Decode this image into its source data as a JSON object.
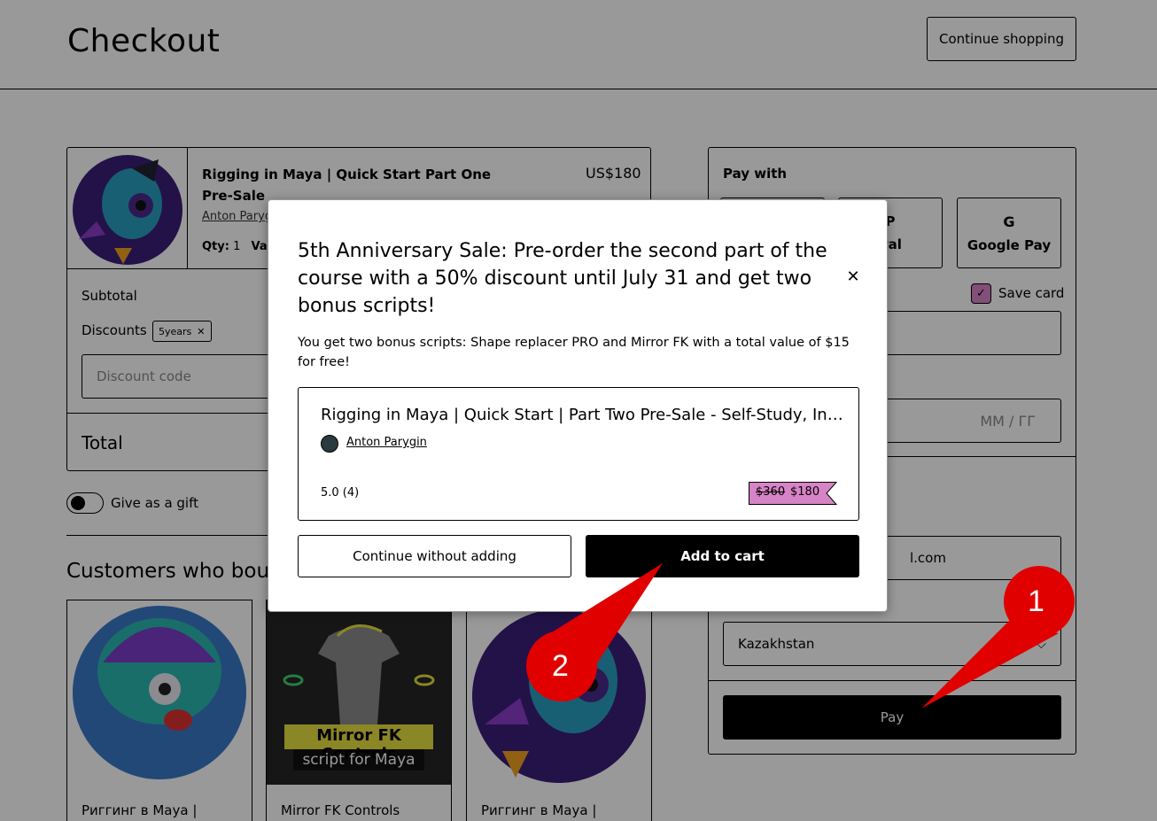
{
  "header": {
    "title": "Checkout",
    "continue_shopping": "Continue shopping"
  },
  "cart": {
    "item": {
      "title": "Rigging in Maya | Quick Start Part One Pre-Sale",
      "price": "US$180",
      "author": "Anton Paryg",
      "qty_label": "Qty:",
      "qty_value": "1",
      "variant_label": "Var"
    },
    "subtotal_label": "Subtotal",
    "discounts_label": "Discounts",
    "discount_chip": "5years",
    "discount_placeholder": "Discount code",
    "total_label": "Total"
  },
  "gift": {
    "label": "Give as a gift",
    "enabled": false
  },
  "customers_heading": "Customers who boug",
  "products": [
    {
      "title": "Риггинг в Maya |"
    },
    {
      "title": "Mirror FK Controls",
      "image_caption_1": "Mirror FK Controls",
      "image_caption_2": "script for Maya"
    },
    {
      "title": "Риггинг в Maya |"
    }
  ],
  "payment": {
    "pay_with_label": "Pay with",
    "methods": [
      {
        "label": "",
        "icon": "card-icon"
      },
      {
        "label": "Pal",
        "icon": "paypal-icon"
      },
      {
        "label": "Google Pay",
        "icon": "google-icon"
      }
    ],
    "save_card_label": "Save card",
    "save_card_checked": true,
    "expiry_placeholder": "MM / ГГ",
    "email_partial": "l.com",
    "country": "Kazakhstan",
    "pay_button": "Pay"
  },
  "modal": {
    "title": "5th Anniversary Sale: Pre-order the second part of the course with a 50% discount until July 31 and get two bonus scripts!",
    "description": "You get two bonus scripts: Shape replacer PRO and Mirror FK with a total value of $15 for free!",
    "offer": {
      "title": "Rigging in Maya | Quick Start | Part Two Pre-Sale - Self-Study, Individual",
      "author": "Anton Parygin",
      "rating": "5.0 (4)",
      "old_price": "$360",
      "new_price": "$180"
    },
    "continue_without_label": "Continue without adding",
    "add_to_cart_label": "Add to cart",
    "close_icon": "close-icon"
  },
  "annotations": [
    {
      "label": "1",
      "color": "#e00000"
    },
    {
      "label": "2",
      "color": "#e00000"
    }
  ],
  "colors": {
    "accent_pink": "#d784c6",
    "button_black": "#000000",
    "marker_red": "#e00000"
  }
}
